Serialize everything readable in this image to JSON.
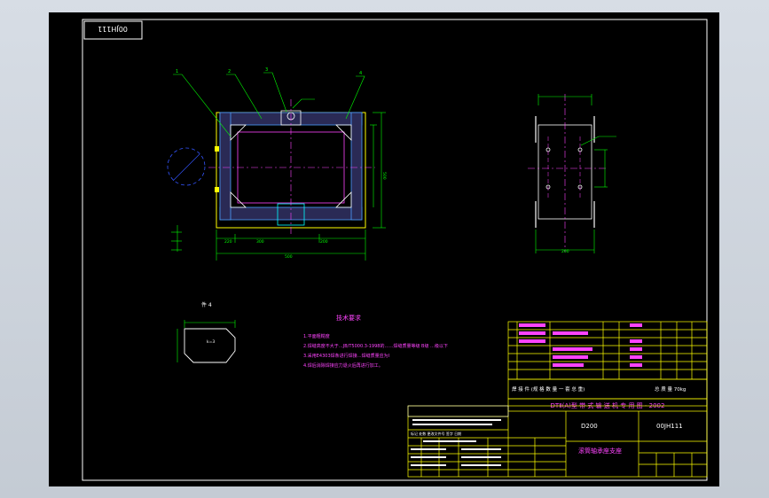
{
  "drawing_code_box": "00JH111",
  "part_label": "件 4",
  "tech_title": "技术要求",
  "tech_notes": [
    "1.平面粗糙度",
    "2.焊缝高度不大于…JB/T5000.3-1998的……焊缝质量等级 B级 …级以下",
    "3.采用E4303焊条进行焊接…焊缝质量应为I",
    "4.焊后消除焊接应力退火后再进行加工。"
  ],
  "view_labels": {
    "part_numbers": [
      "1",
      "2",
      "3",
      "4"
    ],
    "dims_main_bottom": [
      "220",
      "300",
      "200",
      "500"
    ],
    "dims_side_bottom": "200",
    "dim_main_right": "500",
    "part4_label": "k=3"
  },
  "title_block": {
    "total_weight_text": "焊 接 件  (规 格 数 量 一 套 总 重)",
    "weight": "总 质 量 70kg",
    "project_title": "DTⅡ(A)型  带 式 输 送 机 专 用 图 - 2002",
    "model": "D200",
    "drawing_no": "00JH111",
    "drawing_name": "滚筒轴承座支座"
  },
  "revision_header": "标记 处数 更改文件号 签字 日期"
}
